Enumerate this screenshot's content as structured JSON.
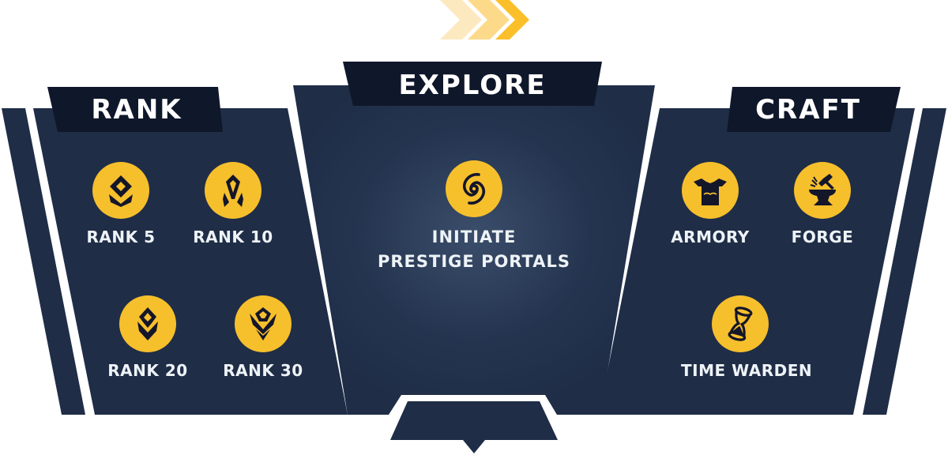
{
  "progress_arrows": {
    "icon": "chevron-arrows-icon",
    "colors": [
      "#fde9c0",
      "#fdd98a",
      "#fbbf2a"
    ]
  },
  "colors": {
    "panel": "#1f2d47",
    "panel_dark": "#111a2e",
    "accent": "#f6bf2c",
    "text": "#eef3f7"
  },
  "sections": {
    "rank": {
      "title": "RANK",
      "items": [
        {
          "label": "RANK 5",
          "icon": "rank-5-emblem-icon"
        },
        {
          "label": "RANK 10",
          "icon": "rank-10-emblem-icon"
        },
        {
          "label": "RANK 20",
          "icon": "rank-20-emblem-icon"
        },
        {
          "label": "RANK 30",
          "icon": "rank-30-emblem-icon"
        }
      ]
    },
    "explore": {
      "title": "EXPLORE",
      "items": [
        {
          "label_line1": "INITIATE",
          "label_line2": "PRESTIGE PORTALS",
          "icon": "portal-swirl-icon"
        }
      ]
    },
    "craft": {
      "title": "CRAFT",
      "items": [
        {
          "label": "ARMORY",
          "icon": "armor-chestplate-icon"
        },
        {
          "label": "FORGE",
          "icon": "anvil-hammer-icon"
        },
        {
          "label": "TIME WARDEN",
          "icon": "hourglass-icon"
        }
      ]
    }
  }
}
